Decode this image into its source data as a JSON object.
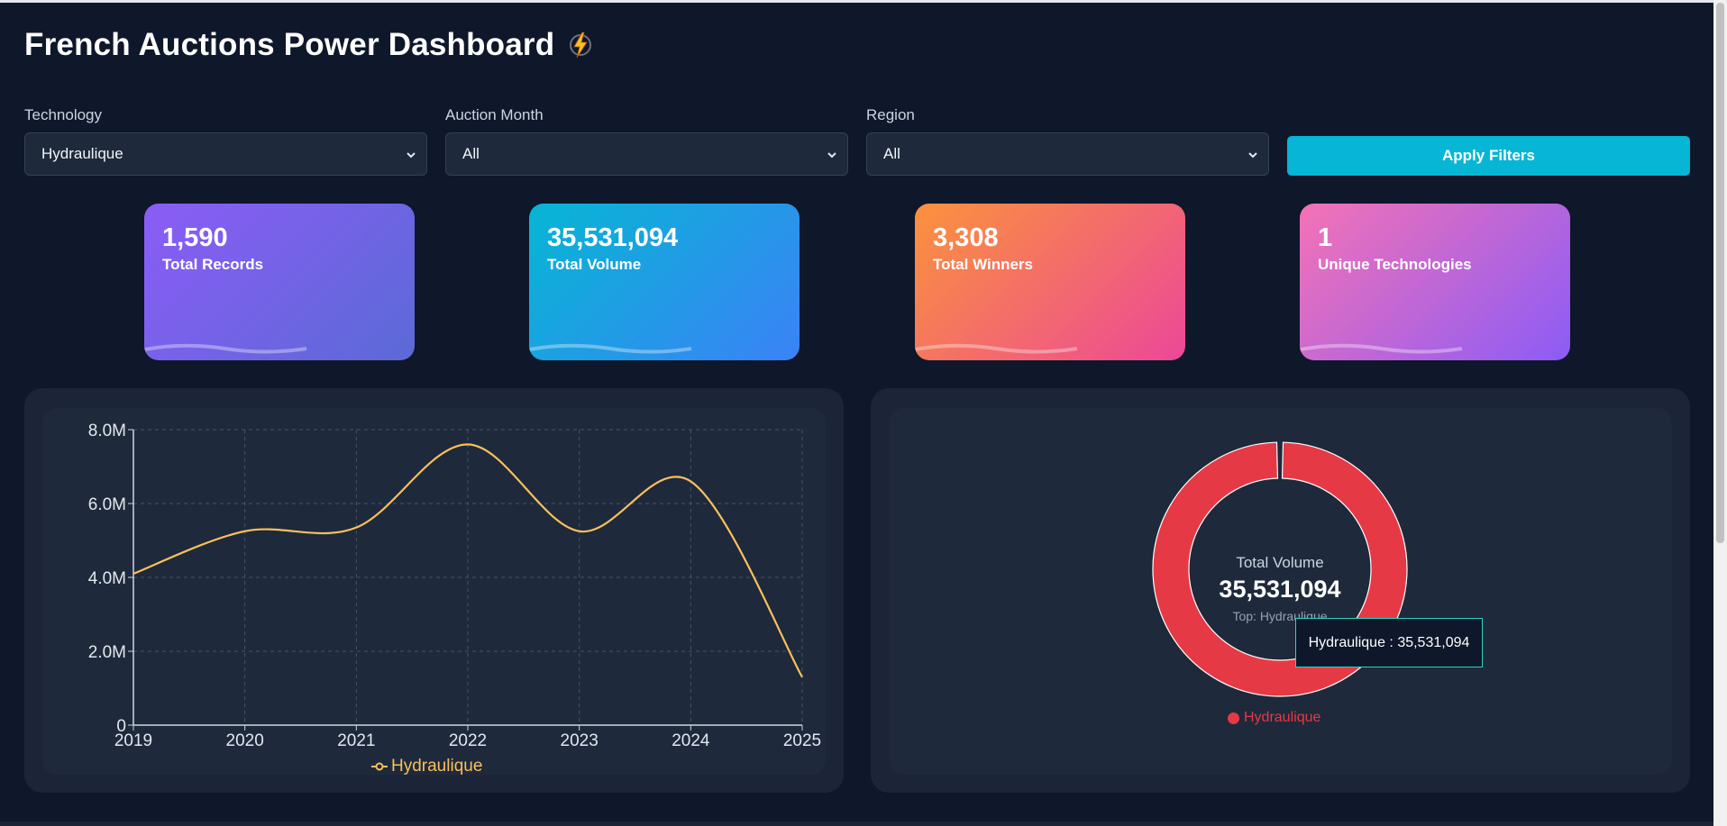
{
  "header": {
    "title": "French Auctions Power Dashboard",
    "icon": "lightning-bolt-icon"
  },
  "filters": [
    {
      "label": "Technology",
      "value": "Hydraulique"
    },
    {
      "label": "Auction Month",
      "value": "All"
    },
    {
      "label": "Region",
      "value": "All"
    }
  ],
  "apply_button": {
    "label": "Apply Filters"
  },
  "stats": [
    {
      "value": "1,590",
      "label": "Total Records",
      "gradient": [
        "#8b5cf6",
        "#5b6ad6"
      ]
    },
    {
      "value": "35,531,094",
      "label": "Total Volume",
      "gradient": [
        "#06b6d4",
        "#3b82f6"
      ]
    },
    {
      "value": "3,308",
      "label": "Total Winners",
      "gradient": [
        "#fb923c",
        "#ec4899"
      ]
    },
    {
      "value": "1",
      "label": "Unique Technologies",
      "gradient": [
        "#f472b6",
        "#8b5cf6"
      ]
    }
  ],
  "chart_data": [
    {
      "type": "line",
      "x": [
        "2019",
        "2020",
        "2021",
        "2022",
        "2023",
        "2024",
        "2025"
      ],
      "series": [
        {
          "name": "Hydraulique",
          "values": [
            4100000,
            5250000,
            5350000,
            7600000,
            5250000,
            6600000,
            1300000
          ],
          "color": "#fbbf5b"
        }
      ],
      "ylim": [
        0,
        8000000
      ],
      "y_ticks": [
        "0",
        "2.0M",
        "4.0M",
        "6.0M",
        "8.0M"
      ],
      "grid": true,
      "legend": "bottom"
    },
    {
      "type": "pie",
      "categories": [
        "Hydraulique"
      ],
      "values": [
        35531094
      ],
      "colors": [
        "#e63946"
      ],
      "center_label": "Total Volume",
      "center_value": "35,531,094",
      "center_sub": "Top: Hydraulique",
      "tooltip": "Hydraulique : 35,531,094",
      "legend": "bottom"
    }
  ]
}
